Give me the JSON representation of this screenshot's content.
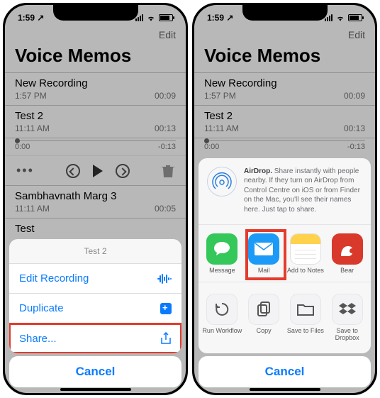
{
  "status": {
    "time": "1:59",
    "loc_arrow": "↗"
  },
  "header": {
    "edit": "Edit",
    "title": "Voice Memos"
  },
  "recordings": [
    {
      "name": "New Recording",
      "time": "1:57 PM",
      "dur": "00:09"
    },
    {
      "name": "Test 2",
      "time": "11:11 AM",
      "dur": "00:13"
    }
  ],
  "playbar": {
    "start": "0:00",
    "end": "-0:13"
  },
  "extra_recordings": [
    {
      "name": "Sambhavnath Marg 3",
      "time": "11:11 AM",
      "dur": "00:05"
    },
    {
      "name": "Test"
    }
  ],
  "action_sheet": {
    "title": "Test 2",
    "rows": [
      {
        "label": "Edit Recording"
      },
      {
        "label": "Duplicate"
      },
      {
        "label": "Share..."
      }
    ],
    "cancel": "Cancel"
  },
  "share_sheet": {
    "airdrop_text_lead": "AirDrop.",
    "airdrop_text_rest": " Share instantly with people nearby. If they turn on AirDrop from Control Centre on iOS or from Finder on the Mac, you'll see their names here. Just tap to share.",
    "apps": [
      {
        "label": "Message"
      },
      {
        "label": "Mail"
      },
      {
        "label": "Add to Notes"
      },
      {
        "label": "Bear"
      }
    ],
    "actions": [
      {
        "label": "Run Workflow"
      },
      {
        "label": "Copy"
      },
      {
        "label": "Save to Files"
      },
      {
        "label": "Save to Dropbox"
      }
    ],
    "cancel": "Cancel"
  }
}
